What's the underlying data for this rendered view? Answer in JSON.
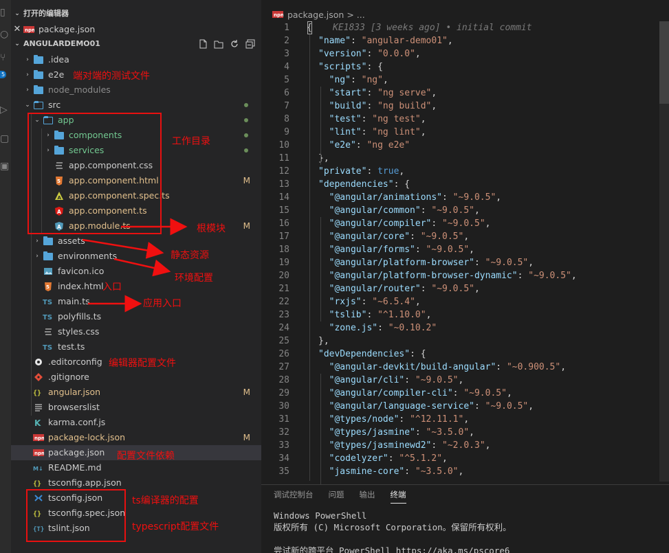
{
  "sidebar": {
    "open_editors_title": "打开的编辑器",
    "open_editors": [
      {
        "label": "package.json"
      }
    ],
    "project_title": "ANGULARDEMO01",
    "tree": [
      {
        "label": ".idea",
        "indent": 1,
        "kind": "folder",
        "status": ""
      },
      {
        "label": "e2e",
        "indent": 1,
        "kind": "folder",
        "status": ""
      },
      {
        "label": "node_modules",
        "indent": 1,
        "kind": "folder",
        "status": ""
      },
      {
        "label": "src",
        "indent": 1,
        "kind": "folder-open",
        "status": ""
      },
      {
        "label": "app",
        "indent": 2,
        "kind": "folder-open",
        "status": ""
      },
      {
        "label": "components",
        "indent": 3,
        "kind": "folder",
        "status": ""
      },
      {
        "label": "services",
        "indent": 3,
        "kind": "folder",
        "status": ""
      },
      {
        "label": "app.component.css",
        "indent": 3,
        "kind": "css",
        "status": ""
      },
      {
        "label": "app.component.html",
        "indent": 3,
        "kind": "html",
        "status": "M"
      },
      {
        "label": "app.component.spec.ts",
        "indent": 3,
        "kind": "spec",
        "status": ""
      },
      {
        "label": "app.component.ts",
        "indent": 3,
        "kind": "angular",
        "status": ""
      },
      {
        "label": "app.module.ts",
        "indent": 3,
        "kind": "module",
        "status": "M"
      },
      {
        "label": "assets",
        "indent": 2,
        "kind": "folder",
        "status": ""
      },
      {
        "label": "environments",
        "indent": 2,
        "kind": "folder",
        "status": ""
      },
      {
        "label": "favicon.ico",
        "indent": 2,
        "kind": "image",
        "status": ""
      },
      {
        "label": "index.html",
        "indent": 2,
        "kind": "html",
        "status": ""
      },
      {
        "label": "main.ts",
        "indent": 2,
        "kind": "ts",
        "status": ""
      },
      {
        "label": "polyfills.ts",
        "indent": 2,
        "kind": "ts",
        "status": ""
      },
      {
        "label": "styles.css",
        "indent": 2,
        "kind": "css",
        "status": ""
      },
      {
        "label": "test.ts",
        "indent": 2,
        "kind": "ts",
        "status": ""
      },
      {
        "label": ".editorconfig",
        "indent": 1,
        "kind": "editorconfig",
        "status": ""
      },
      {
        "label": ".gitignore",
        "indent": 1,
        "kind": "git",
        "status": ""
      },
      {
        "label": "angular.json",
        "indent": 1,
        "kind": "json",
        "status": "M"
      },
      {
        "label": "browserslist",
        "indent": 1,
        "kind": "file",
        "status": ""
      },
      {
        "label": "karma.conf.js",
        "indent": 1,
        "kind": "karma",
        "status": ""
      },
      {
        "label": "package-lock.json",
        "indent": 1,
        "kind": "npm",
        "status": "M"
      },
      {
        "label": "package.json",
        "indent": 1,
        "kind": "npm",
        "status": ""
      },
      {
        "label": "README.md",
        "indent": 1,
        "kind": "md",
        "status": ""
      },
      {
        "label": "tsconfig.app.json",
        "indent": 1,
        "kind": "json",
        "status": ""
      },
      {
        "label": "tsconfig.json",
        "indent": 1,
        "kind": "tsconfig",
        "status": ""
      },
      {
        "label": "tsconfig.spec.json",
        "indent": 1,
        "kind": "json",
        "status": ""
      },
      {
        "label": "tslint.json",
        "indent": 1,
        "kind": "tslint",
        "status": ""
      }
    ]
  },
  "annotations": {
    "e2e": "端对端的测试文件",
    "app": "工作目录",
    "module": "根模块",
    "assets": "静态资源",
    "environments": "环境配置",
    "index": "入口",
    "main": "应用入口",
    "editorconfig": "编辑器配置文件",
    "package": "配置文件依赖",
    "tsconfig": "ts编译器的配置",
    "tslint": "typescript配置文件"
  },
  "editor": {
    "breadcrumb_file": "package.json",
    "breadcrumb_sep": ">",
    "breadcrumb_more": "...",
    "blame": "KE1833 [3 weeks ago] • initial commit",
    "lines": [
      [
        [
          "p",
          "{"
        ]
      ],
      [
        [
          "k",
          "\"name\""
        ],
        [
          "p",
          ": "
        ],
        [
          "s",
          "\"angular-demo01\""
        ],
        [
          "p",
          ","
        ]
      ],
      [
        [
          "k",
          "\"version\""
        ],
        [
          "p",
          ": "
        ],
        [
          "s",
          "\"0.0.0\""
        ],
        [
          "p",
          ","
        ]
      ],
      [
        [
          "k",
          "\"scripts\""
        ],
        [
          "p",
          ": {"
        ]
      ],
      [
        [
          "k",
          "  \"ng\""
        ],
        [
          "p",
          ": "
        ],
        [
          "s",
          "\"ng\""
        ],
        [
          "p",
          ","
        ]
      ],
      [
        [
          "k",
          "  \"start\""
        ],
        [
          "p",
          ": "
        ],
        [
          "s",
          "\"ng serve\""
        ],
        [
          "p",
          ","
        ]
      ],
      [
        [
          "k",
          "  \"build\""
        ],
        [
          "p",
          ": "
        ],
        [
          "s",
          "\"ng build\""
        ],
        [
          "p",
          ","
        ]
      ],
      [
        [
          "k",
          "  \"test\""
        ],
        [
          "p",
          ": "
        ],
        [
          "s",
          "\"ng test\""
        ],
        [
          "p",
          ","
        ]
      ],
      [
        [
          "k",
          "  \"lint\""
        ],
        [
          "p",
          ": "
        ],
        [
          "s",
          "\"ng lint\""
        ],
        [
          "p",
          ","
        ]
      ],
      [
        [
          "k",
          "  \"e2e\""
        ],
        [
          "p",
          ": "
        ],
        [
          "s",
          "\"ng e2e\""
        ]
      ],
      [
        [
          "p",
          "},"
        ]
      ],
      [
        [
          "k",
          "\"private\""
        ],
        [
          "p",
          ": "
        ],
        [
          "b",
          "true"
        ],
        [
          "p",
          ","
        ]
      ],
      [
        [
          "k",
          "\"dependencies\""
        ],
        [
          "p",
          ": {"
        ]
      ],
      [
        [
          "k",
          "  \"@angular/animations\""
        ],
        [
          "p",
          ": "
        ],
        [
          "s",
          "\"~9.0.5\""
        ],
        [
          "p",
          ","
        ]
      ],
      [
        [
          "k",
          "  \"@angular/common\""
        ],
        [
          "p",
          ": "
        ],
        [
          "s",
          "\"~9.0.5\""
        ],
        [
          "p",
          ","
        ]
      ],
      [
        [
          "k",
          "  \"@angular/compiler\""
        ],
        [
          "p",
          ": "
        ],
        [
          "s",
          "\"~9.0.5\""
        ],
        [
          "p",
          ","
        ]
      ],
      [
        [
          "k",
          "  \"@angular/core\""
        ],
        [
          "p",
          ": "
        ],
        [
          "s",
          "\"~9.0.5\""
        ],
        [
          "p",
          ","
        ]
      ],
      [
        [
          "k",
          "  \"@angular/forms\""
        ],
        [
          "p",
          ": "
        ],
        [
          "s",
          "\"~9.0.5\""
        ],
        [
          "p",
          ","
        ]
      ],
      [
        [
          "k",
          "  \"@angular/platform-browser\""
        ],
        [
          "p",
          ": "
        ],
        [
          "s",
          "\"~9.0.5\""
        ],
        [
          "p",
          ","
        ]
      ],
      [
        [
          "k",
          "  \"@angular/platform-browser-dynamic\""
        ],
        [
          "p",
          ": "
        ],
        [
          "s",
          "\"~9.0.5\""
        ],
        [
          "p",
          ","
        ]
      ],
      [
        [
          "k",
          "  \"@angular/router\""
        ],
        [
          "p",
          ": "
        ],
        [
          "s",
          "\"~9.0.5\""
        ],
        [
          "p",
          ","
        ]
      ],
      [
        [
          "k",
          "  \"rxjs\""
        ],
        [
          "p",
          ": "
        ],
        [
          "s",
          "\"~6.5.4\""
        ],
        [
          "p",
          ","
        ]
      ],
      [
        [
          "k",
          "  \"tslib\""
        ],
        [
          "p",
          ": "
        ],
        [
          "s",
          "\"^1.10.0\""
        ],
        [
          "p",
          ","
        ]
      ],
      [
        [
          "k",
          "  \"zone.js\""
        ],
        [
          "p",
          ": "
        ],
        [
          "s",
          "\"~0.10.2\""
        ]
      ],
      [
        [
          "p",
          "},"
        ]
      ],
      [
        [
          "k",
          "\"devDependencies\""
        ],
        [
          "p",
          ": {"
        ]
      ],
      [
        [
          "k",
          "  \"@angular-devkit/build-angular\""
        ],
        [
          "p",
          ": "
        ],
        [
          "s",
          "\"~0.900.5\""
        ],
        [
          "p",
          ","
        ]
      ],
      [
        [
          "k",
          "  \"@angular/cli\""
        ],
        [
          "p",
          ": "
        ],
        [
          "s",
          "\"~9.0.5\""
        ],
        [
          "p",
          ","
        ]
      ],
      [
        [
          "k",
          "  \"@angular/compiler-cli\""
        ],
        [
          "p",
          ": "
        ],
        [
          "s",
          "\"~9.0.5\""
        ],
        [
          "p",
          ","
        ]
      ],
      [
        [
          "k",
          "  \"@angular/language-service\""
        ],
        [
          "p",
          ": "
        ],
        [
          "s",
          "\"~9.0.5\""
        ],
        [
          "p",
          ","
        ]
      ],
      [
        [
          "k",
          "  \"@types/node\""
        ],
        [
          "p",
          ": "
        ],
        [
          "s",
          "\"^12.11.1\""
        ],
        [
          "p",
          ","
        ]
      ],
      [
        [
          "k",
          "  \"@types/jasmine\""
        ],
        [
          "p",
          ": "
        ],
        [
          "s",
          "\"~3.5.0\""
        ],
        [
          "p",
          ","
        ]
      ],
      [
        [
          "k",
          "  \"@types/jasminewd2\""
        ],
        [
          "p",
          ": "
        ],
        [
          "s",
          "\"~2.0.3\""
        ],
        [
          "p",
          ","
        ]
      ],
      [
        [
          "k",
          "  \"codelyzer\""
        ],
        [
          "p",
          ": "
        ],
        [
          "s",
          "\"^5.1.2\""
        ],
        [
          "p",
          ","
        ]
      ],
      [
        [
          "k",
          "  \"jasmine-core\""
        ],
        [
          "p",
          ": "
        ],
        [
          "s",
          "\"~3.5.0\""
        ],
        [
          "p",
          ","
        ]
      ]
    ]
  },
  "panel": {
    "tabs": [
      "调试控制台",
      "问题",
      "输出",
      "终端"
    ],
    "active_tab": "终端",
    "terminal_lines": [
      "Windows PowerShell",
      "版权所有 (C) Microsoft Corporation。保留所有权利。",
      "",
      "尝试新的跨平台 PowerShell https://aka.ms/pscore6"
    ]
  },
  "colors": {
    "annotation": "#f01010",
    "modified": "#e2c08d",
    "untracked": "#73c991",
    "folder": "#55a5d9"
  }
}
